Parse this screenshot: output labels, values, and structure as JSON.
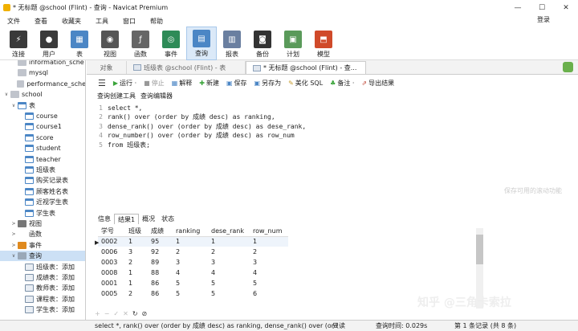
{
  "window": {
    "title": "* 无标题 @school (Flint) - 查询 - Navicat Premium",
    "min": "—",
    "max": "☐",
    "close": "✕"
  },
  "menu": [
    "文件",
    "查看",
    "收藏夹",
    "工具",
    "窗口",
    "帮助"
  ],
  "login": "登录",
  "toolbar": [
    {
      "label": "连接",
      "color": "#3a3a3a"
    },
    {
      "label": "用户",
      "color": "#3a3a3a"
    },
    {
      "label": "表",
      "color": "#4b86c5"
    },
    {
      "label": "视图",
      "color": "#555555"
    },
    {
      "label": "函数",
      "color": "#666666"
    },
    {
      "label": "事件",
      "color": "#2e8b57"
    },
    {
      "label": "查询",
      "color": "#4b86c5"
    },
    {
      "label": "报表",
      "color": "#6a7fa0"
    },
    {
      "label": "备份",
      "color": "#333333"
    },
    {
      "label": "计划",
      "color": "#5a9a5a"
    },
    {
      "label": "模型",
      "color": "#d04a2a"
    }
  ],
  "sidebar": [
    {
      "label": "information_sche",
      "type": "db",
      "indent": 1,
      "toggle": ""
    },
    {
      "label": "mysql",
      "type": "db",
      "indent": 1,
      "toggle": ""
    },
    {
      "label": "performance_sche",
      "type": "db",
      "indent": 1,
      "toggle": ""
    },
    {
      "label": "school",
      "type": "db",
      "indent": 0,
      "toggle": "∨"
    },
    {
      "label": "表",
      "type": "tbl",
      "indent": 1,
      "toggle": "∨"
    },
    {
      "label": "course",
      "type": "tbl",
      "indent": 2,
      "toggle": ""
    },
    {
      "label": "course1",
      "type": "tbl",
      "indent": 2,
      "toggle": ""
    },
    {
      "label": "score",
      "type": "tbl",
      "indent": 2,
      "toggle": ""
    },
    {
      "label": "student",
      "type": "tbl",
      "indent": 2,
      "toggle": ""
    },
    {
      "label": "teacher",
      "type": "tbl",
      "indent": 2,
      "toggle": ""
    },
    {
      "label": "班级表",
      "type": "tbl",
      "indent": 2,
      "toggle": ""
    },
    {
      "label": "购买记录表",
      "type": "tbl",
      "indent": 2,
      "toggle": ""
    },
    {
      "label": "顾客姓名表",
      "type": "tbl",
      "indent": 2,
      "toggle": ""
    },
    {
      "label": "近视学生表",
      "type": "tbl",
      "indent": 2,
      "toggle": ""
    },
    {
      "label": "学生表",
      "type": "tbl",
      "indent": 2,
      "toggle": ""
    },
    {
      "label": "视图",
      "type": "view",
      "indent": 1,
      "toggle": ">"
    },
    {
      "label": "函数",
      "type": "func",
      "indent": 1,
      "toggle": ">"
    },
    {
      "label": "事件",
      "type": "evt",
      "indent": 1,
      "toggle": ">"
    },
    {
      "label": "查询",
      "type": "qry",
      "indent": 1,
      "toggle": "∨"
    },
    {
      "label": "班级表：添加",
      "type": "q",
      "indent": 2,
      "toggle": ""
    },
    {
      "label": "成绩表：添加",
      "type": "q",
      "indent": 2,
      "toggle": ""
    },
    {
      "label": "教师表：添加",
      "type": "q",
      "indent": 2,
      "toggle": ""
    },
    {
      "label": "课程表：添加",
      "type": "q",
      "indent": 2,
      "toggle": ""
    },
    {
      "label": "学生表：添加",
      "type": "q",
      "indent": 2,
      "toggle": ""
    }
  ],
  "tabs": {
    "objects": "对象",
    "tab1": "班级表 @school (Flint) - 表",
    "tab2": "* 无标题 @school (Flint) - 查..."
  },
  "qtool": {
    "run": "运行 ·",
    "stop": "停止",
    "explain": "解释",
    "new": "新建",
    "save": "保存",
    "saveas": "另存为",
    "beautify": "美化 SQL",
    "note": "备注 ·",
    "export": "导出结果"
  },
  "subtabs": [
    "查询创建工具",
    "查询编辑器"
  ],
  "sql_lines": [
    "select *,",
    "rank() over (order by 成绩 desc) as ranking,",
    "dense_rank() over (order by 成绩 desc) as dese_rank,",
    "row_number() over (order by 成绩 desc) as row_num",
    "from 班级表;"
  ],
  "watermark": "保存可用的滚动功能",
  "result_tabs": [
    "信息",
    "结果1",
    "概况",
    "状态"
  ],
  "grid": {
    "columns": [
      "学号",
      "班级",
      "成绩",
      "ranking",
      "dese_rank",
      "row_num"
    ],
    "rows": [
      [
        "0002",
        "1",
        "95",
        "1",
        "1",
        "1"
      ],
      [
        "0006",
        "3",
        "92",
        "2",
        "2",
        "2"
      ],
      [
        "0003",
        "2",
        "89",
        "3",
        "3",
        "3"
      ],
      [
        "0008",
        "1",
        "88",
        "4",
        "4",
        "4"
      ],
      [
        "0001",
        "1",
        "86",
        "5",
        "5",
        "5"
      ],
      [
        "0005",
        "2",
        "86",
        "5",
        "5",
        "6"
      ]
    ]
  },
  "status": {
    "sql": "select *, rank() over (order by 成绩 desc) as ranking, dense_rank() over (ord",
    "readonly": "只读",
    "time": "查询时间: 0.029s",
    "records": "第 1 条记录 (共 8 条)"
  },
  "brand_watermark": "知乎 @三角卡索拉"
}
